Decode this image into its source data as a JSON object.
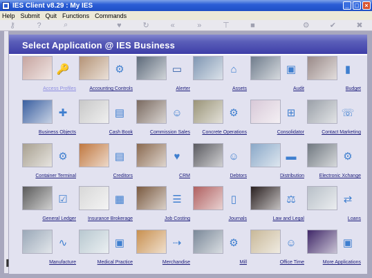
{
  "window": {
    "title": "IES Client v8.29 : My IES"
  },
  "menu": [
    "Help",
    "Submit",
    "Quit",
    "Functions",
    "Commands"
  ],
  "banner": {
    "title": "Select Application @ IES Business"
  },
  "apps": [
    {
      "label": "Access Profiles",
      "icon": "key-icon",
      "glyph": "🔑",
      "color": "#4a8fd8",
      "photo": "#c7a5a0",
      "dim": true
    },
    {
      "label": "Accounting Controls",
      "icon": "settings-icon",
      "glyph": "⚙",
      "color": "#3f7fcf",
      "photo": "#b59477"
    },
    {
      "label": "Alerter",
      "icon": "alert-device-icon",
      "glyph": "▭",
      "color": "#2f5fa8",
      "photo": "#5d6a7a"
    },
    {
      "label": "Assets",
      "icon": "house-icon",
      "glyph": "⌂",
      "color": "#3f7fcf",
      "photo": "#8097b3"
    },
    {
      "label": "Audit",
      "icon": "monitor-icon",
      "glyph": "▣",
      "color": "#3f7fcf",
      "photo": "#6f7c8c"
    },
    {
      "label": "Budget",
      "icon": "bar-chart-icon",
      "glyph": "▮",
      "color": "#3f7fcf",
      "photo": "#9a8a88"
    },
    {
      "label": "Business Objects",
      "icon": "puzzle-icon",
      "glyph": "✚",
      "color": "#3f7fcf",
      "photo": "#3a5fa0"
    },
    {
      "label": "Cash Book",
      "icon": "card-icon",
      "glyph": "▤",
      "color": "#3f7fcf",
      "photo": "#c8c8c8"
    },
    {
      "label": "Commission Sales",
      "icon": "people-icon",
      "glyph": "☺",
      "color": "#3f7fcf",
      "photo": "#7a6a60"
    },
    {
      "label": "Concrete Operations",
      "icon": "gear-icon",
      "glyph": "⚙",
      "color": "#3f7fcf",
      "photo": "#9a9478"
    },
    {
      "label": "Consolidator",
      "icon": "network-icon",
      "glyph": "⊞",
      "color": "#3f7fcf",
      "photo": "#d8c9d8"
    },
    {
      "label": "Contact Marketing",
      "icon": "contact-icon",
      "glyph": "☏",
      "color": "#3f7fcf",
      "photo": "#9aa0a8"
    },
    {
      "label": "Container Terminal",
      "icon": "gear-icon",
      "glyph": "⚙",
      "color": "#3f7fcf",
      "photo": "#a8a090"
    },
    {
      "label": "Creditors",
      "icon": "credit-card-icon",
      "glyph": "▤",
      "color": "#3f7fcf",
      "photo": "#c07840"
    },
    {
      "label": "CRM",
      "icon": "heart-icon",
      "glyph": "♥",
      "color": "#3f7fcf",
      "photo": "#8a6a50"
    },
    {
      "label": "Debtors",
      "icon": "people-icon",
      "glyph": "☺",
      "color": "#3f7fcf",
      "photo": "#5a5a60"
    },
    {
      "label": "Distribution",
      "icon": "truck-icon",
      "glyph": "▬",
      "color": "#3f7fcf",
      "photo": "#8aa8c8"
    },
    {
      "label": "Electronic Xchange",
      "icon": "gear-icon",
      "glyph": "⚙",
      "color": "#3f7fcf",
      "photo": "#707880"
    },
    {
      "label": "General Ledger",
      "icon": "checklist-icon",
      "glyph": "☑",
      "color": "#3f7fcf",
      "photo": "#5a5a5a"
    },
    {
      "label": "Insurance Brokerage",
      "icon": "folders-icon",
      "glyph": "▦",
      "color": "#3f7fcf",
      "photo": "#d8d8d8"
    },
    {
      "label": "Job Costing",
      "icon": "chat-icon",
      "glyph": "☰",
      "color": "#3f7fcf",
      "photo": "#7a5a40"
    },
    {
      "label": "Journals",
      "icon": "document-icon",
      "glyph": "▯",
      "color": "#3f7fcf",
      "photo": "#b06060"
    },
    {
      "label": "Law and Legal",
      "icon": "gavel-icon",
      "glyph": "⚖",
      "color": "#3f7fcf",
      "photo": "#2a2020"
    },
    {
      "label": "Loans",
      "icon": "exchange-icon",
      "glyph": "⇄",
      "color": "#3f7fcf",
      "photo": "#b8c0c8"
    },
    {
      "label": "Manufacture",
      "icon": "graph-icon",
      "glyph": "∿",
      "color": "#3f7fcf",
      "photo": "#9aa8b8"
    },
    {
      "label": "Medical Practice",
      "icon": "images-icon",
      "glyph": "▣",
      "color": "#3f7fcf",
      "photo": "#b8c8d0"
    },
    {
      "label": "Merchandise",
      "icon": "arrows-icon",
      "glyph": "⇢",
      "color": "#3f7fcf",
      "photo": "#c89050"
    },
    {
      "label": "Mill",
      "icon": "gear-icon",
      "glyph": "⚙",
      "color": "#3f7fcf",
      "photo": "#7a8898"
    },
    {
      "label": "Office Time",
      "icon": "people-gear-icon",
      "glyph": "☺",
      "color": "#3f7fcf",
      "photo": "#c8b898"
    },
    {
      "label": "More Applications",
      "icon": "monitor-icon",
      "glyph": "▣",
      "color": "#3f7fcf",
      "photo": "#402868"
    }
  ]
}
